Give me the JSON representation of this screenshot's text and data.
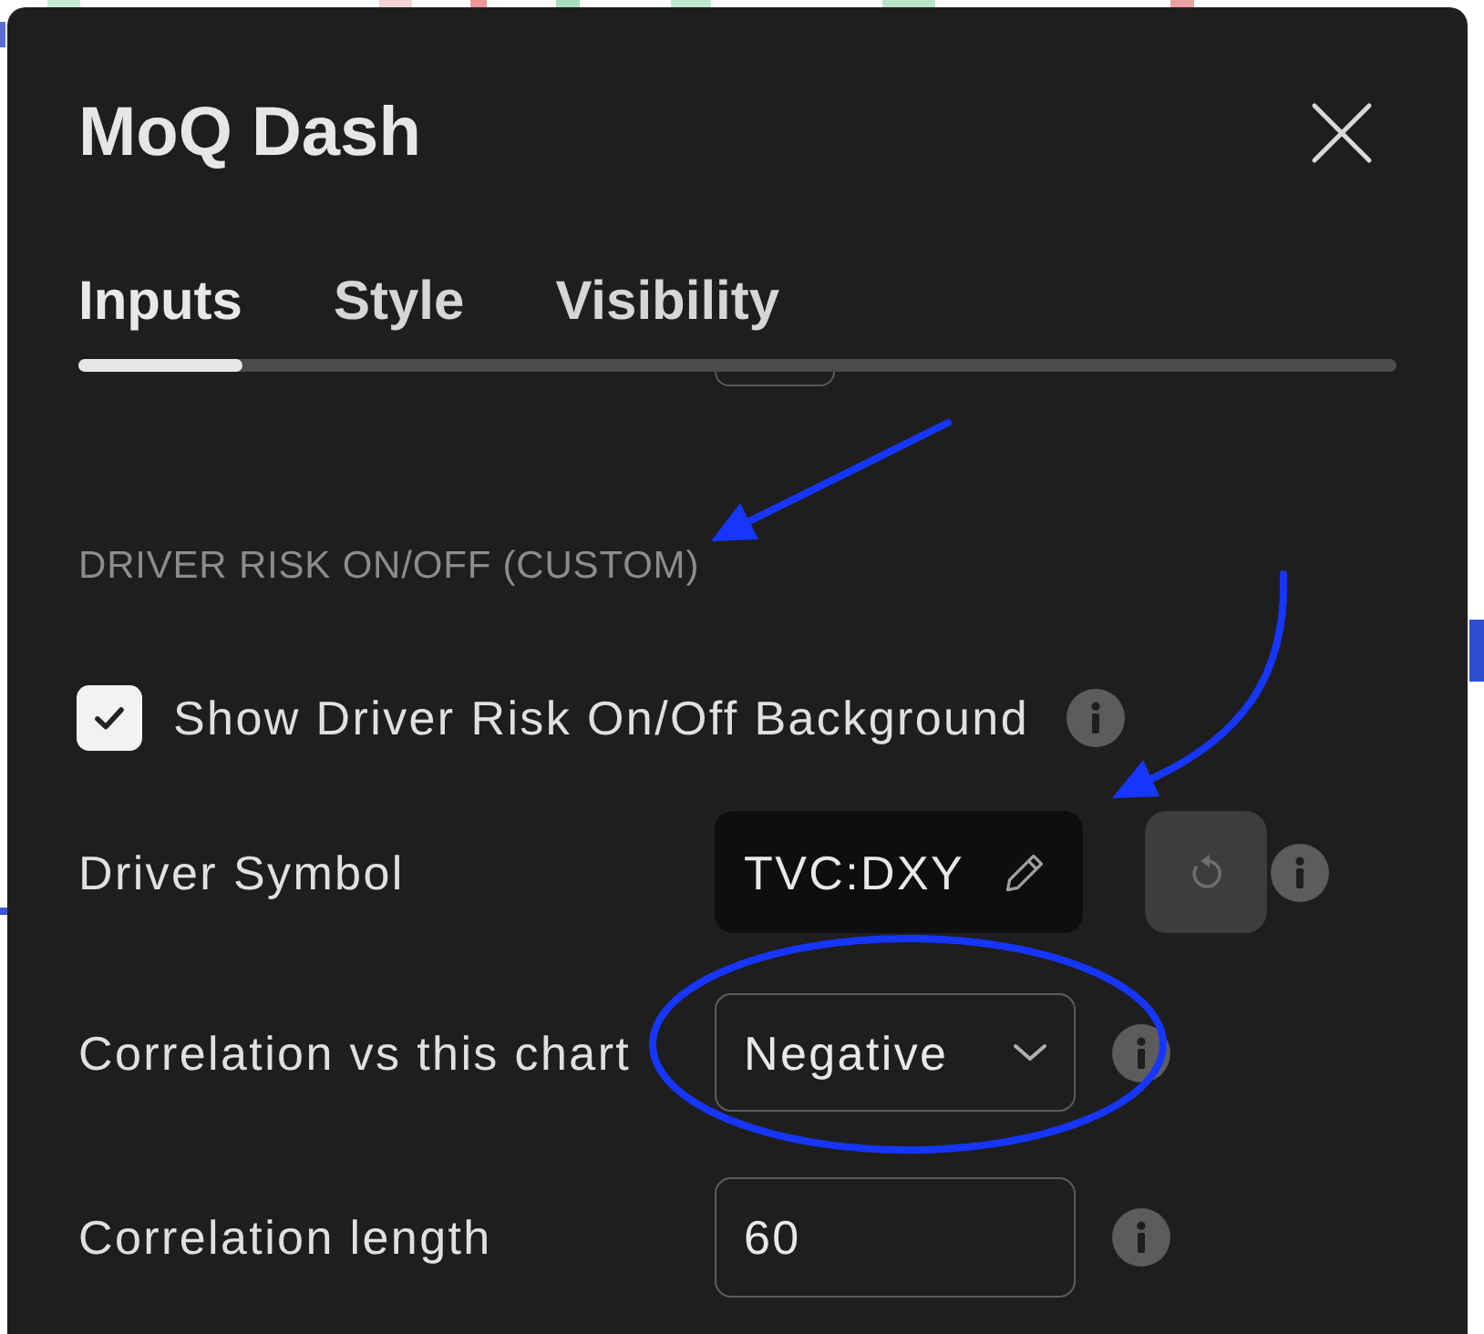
{
  "dialog": {
    "title": "MoQ Dash"
  },
  "tabs": [
    {
      "label": "Inputs",
      "selected": true
    },
    {
      "label": "Style",
      "selected": false
    },
    {
      "label": "Visibility",
      "selected": false
    }
  ],
  "section": {
    "heading": "DRIVER RISK ON/OFF (CUSTOM)"
  },
  "inputs": [
    {
      "kind": "checkbox",
      "label": "Show Driver Risk On/Off Background",
      "checked": true
    },
    {
      "kind": "symbol",
      "label": "Driver Symbol",
      "value": "TVC:DXY",
      "reset_button": {
        "disabled": true
      }
    },
    {
      "kind": "select",
      "label": "Correlation vs this chart",
      "value": "Negative"
    },
    {
      "kind": "number",
      "label": "Correlation length",
      "value": "60"
    }
  ],
  "annotations": [
    {
      "kind": "arrow"
    },
    {
      "kind": "curved_arrow"
    },
    {
      "kind": "ellipse"
    }
  ]
}
